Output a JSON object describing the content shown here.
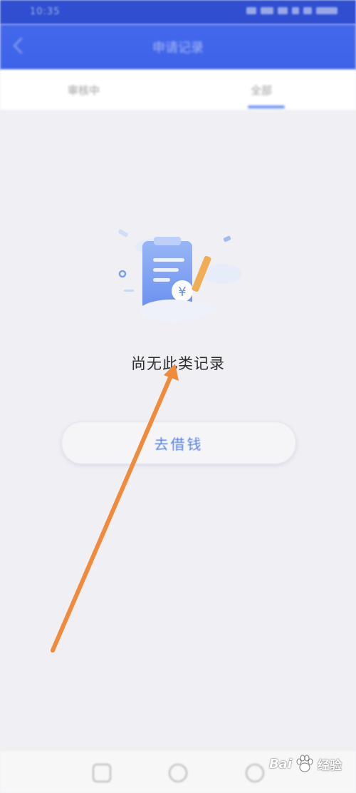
{
  "status_bar": {
    "time": "10:35"
  },
  "header": {
    "title": "申请记录"
  },
  "tabs": [
    {
      "label": "审核中"
    },
    {
      "label": "全部"
    }
  ],
  "empty_state": {
    "message": "尚无此类记录",
    "illustration_icon": "document-yen-icon"
  },
  "action": {
    "borrow_label": "去借钱"
  },
  "watermark": {
    "brand": "Bai",
    "suffix": "经验"
  },
  "colors": {
    "header_blue": "#3d63ea",
    "accent_blue": "#5b83e6",
    "arrow_orange": "#f08a3c",
    "background": "#efeff4"
  }
}
